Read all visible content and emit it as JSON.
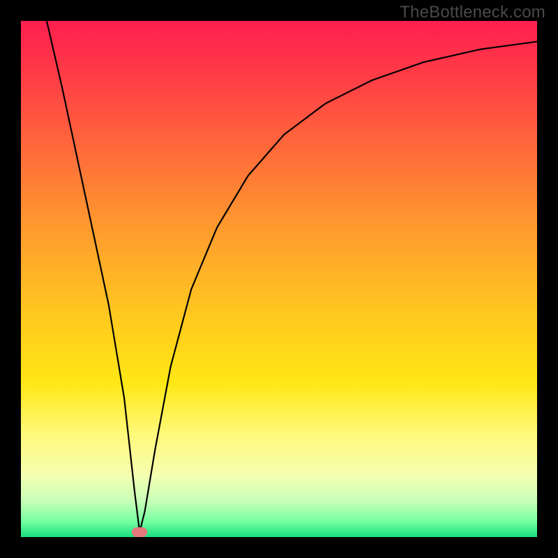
{
  "watermark": "TheBottleneck.com",
  "chart_data": {
    "type": "line",
    "title": "",
    "xlabel": "",
    "ylabel": "",
    "xlim": [
      0,
      100
    ],
    "ylim": [
      0,
      100
    ],
    "grid": false,
    "legend": false,
    "notes": "V-shaped bottleneck curve on vertical red-yellow-green gradient; minimum ≈ x=23, y≈0. Pink rounded marker at minimum.",
    "gradient_stops": [
      {
        "offset": 0.0,
        "color": "#ff1f4f"
      },
      {
        "offset": 0.1,
        "color": "#ff3a47"
      },
      {
        "offset": 0.25,
        "color": "#ff6a3a"
      },
      {
        "offset": 0.4,
        "color": "#ff9a2e"
      },
      {
        "offset": 0.55,
        "color": "#ffc321"
      },
      {
        "offset": 0.7,
        "color": "#ffe714"
      },
      {
        "offset": 0.8,
        "color": "#fff97a"
      },
      {
        "offset": 0.88,
        "color": "#f4ffb0"
      },
      {
        "offset": 0.93,
        "color": "#c8ffb8"
      },
      {
        "offset": 0.97,
        "color": "#74ffa0"
      },
      {
        "offset": 1.0,
        "color": "#18e080"
      }
    ],
    "series": [
      {
        "name": "bottleneck-curve",
        "x": [
          5,
          8,
          11,
          14,
          17,
          20,
          22,
          23,
          24,
          26,
          29,
          33,
          38,
          44,
          51,
          59,
          68,
          78,
          89,
          100
        ],
        "y": [
          100,
          87,
          73,
          59,
          45,
          27,
          9,
          1,
          5,
          17,
          33,
          48,
          60,
          70,
          78,
          84,
          88.5,
          92,
          94.5,
          96
        ]
      }
    ],
    "marker": {
      "x": 23,
      "y": 1,
      "color": "#e47a7a"
    }
  }
}
